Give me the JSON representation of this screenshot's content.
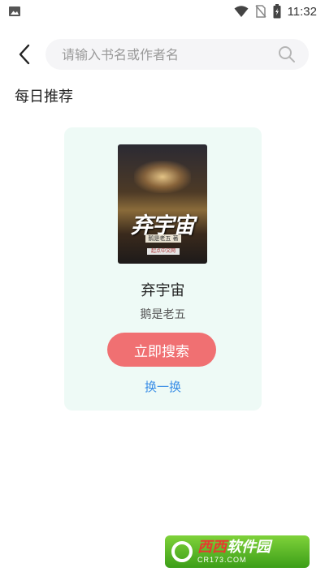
{
  "status_bar": {
    "time": "11:32",
    "icons": [
      "image-icon",
      "wifi-icon",
      "no-sim-icon",
      "battery-icon"
    ]
  },
  "header": {
    "search_placeholder": "请输入书名或作者名",
    "back_icon": "chevron-left-icon",
    "search_icon": "search-icon"
  },
  "section": {
    "title": "每日推荐"
  },
  "recommend": {
    "cover_title": "弃宇宙",
    "cover_author": "鹅是老五 著",
    "cover_logo": "起点中文网",
    "book_title": "弃宇宙",
    "book_author": "鹅是老五",
    "search_button": "立即搜索",
    "change_link": "换一换"
  },
  "colors": {
    "card_bg": "#eefaf6",
    "button_bg": "#f07072",
    "link": "#3a8ee6"
  },
  "watermark": {
    "main_a": "西西",
    "main_b": "软件园",
    "sub": "CR173.COM"
  }
}
